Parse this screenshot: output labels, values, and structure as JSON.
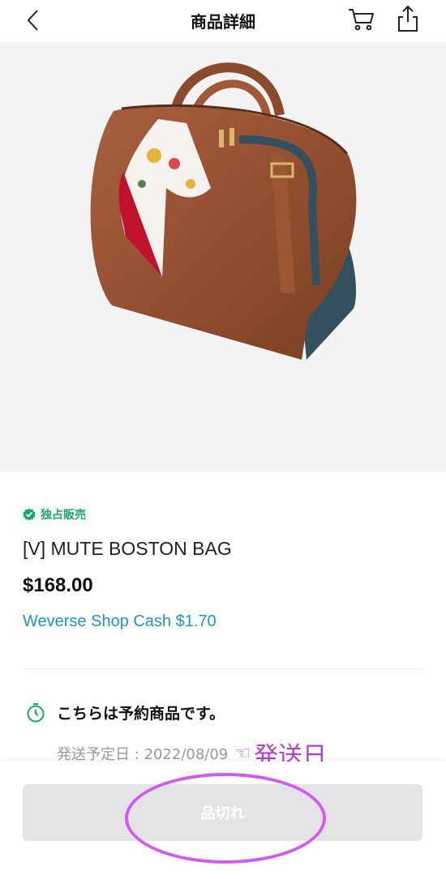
{
  "header": {
    "title": "商品詳細",
    "back_icon": "chevron-left-icon",
    "cart_icon": "cart-icon",
    "share_icon": "share-icon"
  },
  "product": {
    "image_icon": "boston-bag-photo",
    "badge_label": "独占販売",
    "badge_color": "#17a86d",
    "name": "[V] MUTE BOSTON BAG",
    "price": "$168.00",
    "cash": "Weverse Shop Cash $1.70",
    "cash_color": "#1f95c7"
  },
  "preorder": {
    "text": "こちらは予約商品です。",
    "ship_label": "発送予定日 : 2022/08/09",
    "annotation_pointer": "☜",
    "annotation_text": "発送日",
    "annotation_color": "#b23fd0"
  },
  "footer": {
    "soldout_label": "品切れ"
  }
}
